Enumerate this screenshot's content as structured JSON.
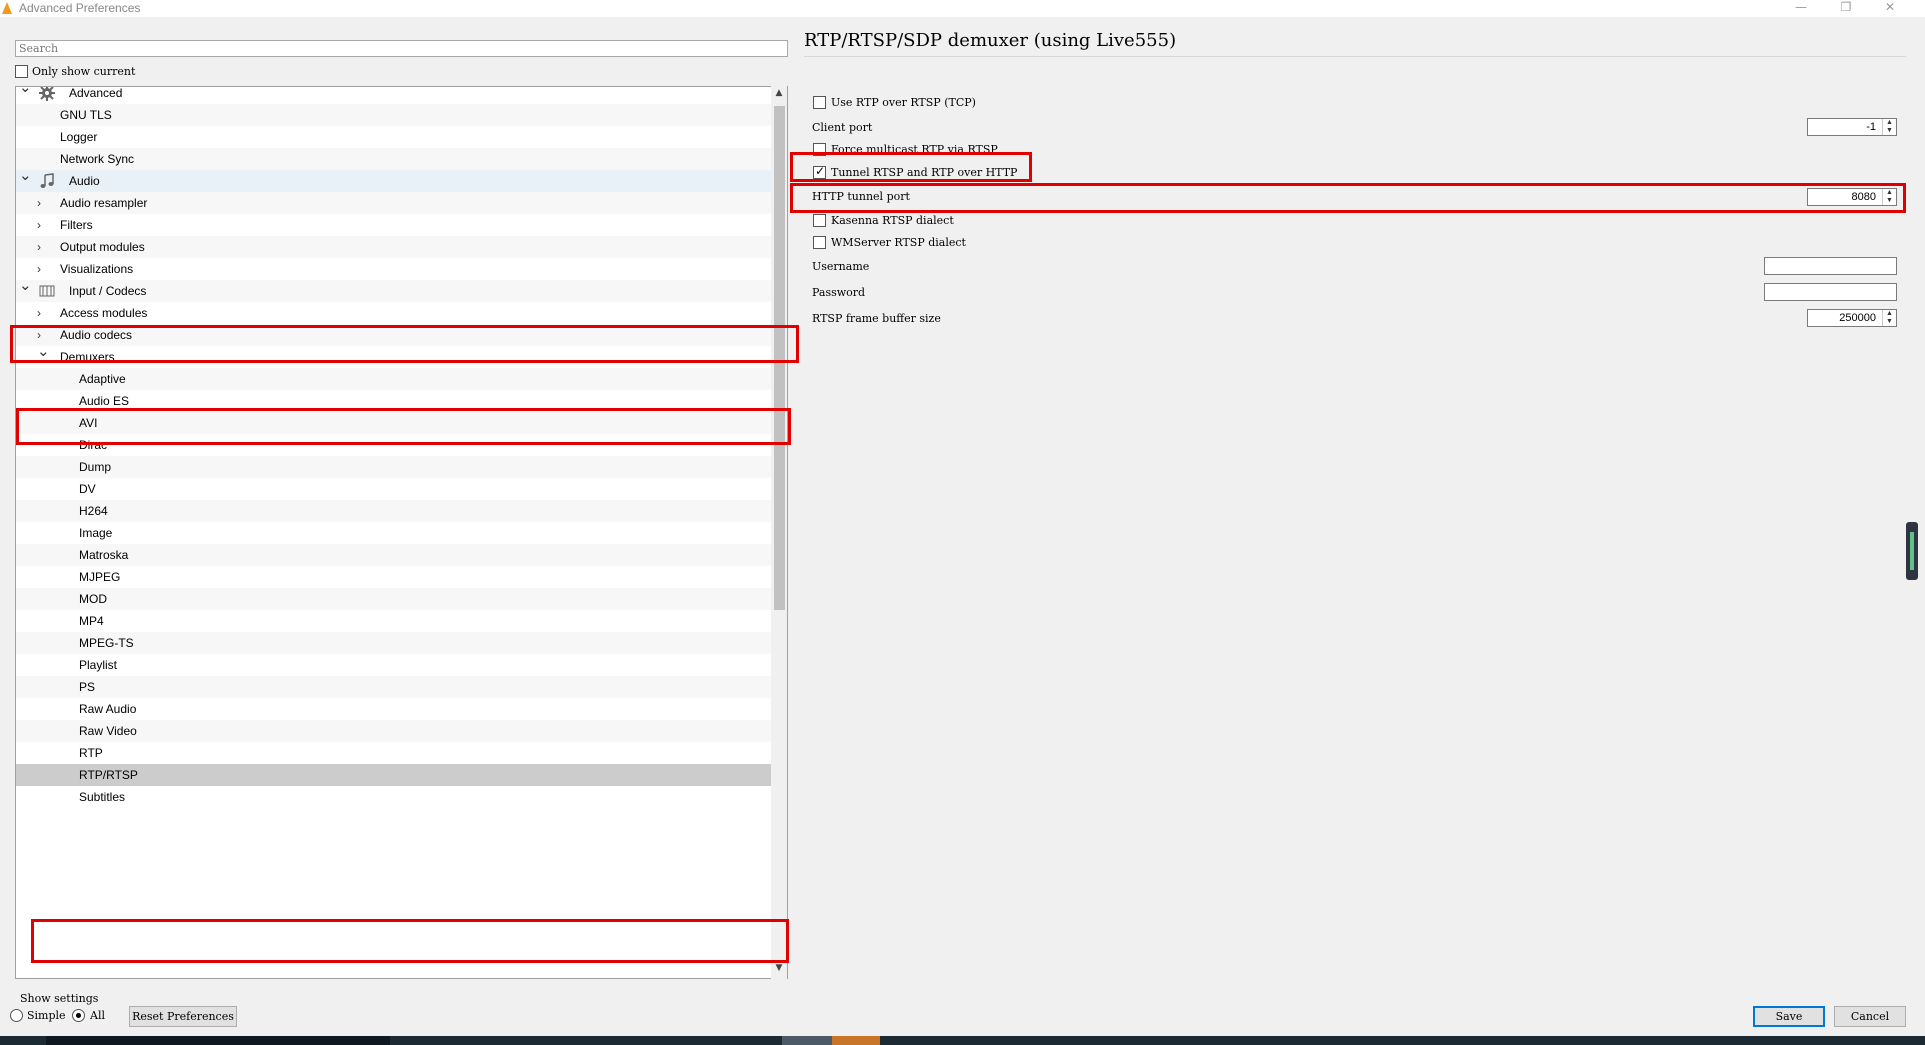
{
  "window": {
    "title": "Advanced Preferences",
    "minimize_icon": "minimize-icon",
    "maximize_icon": "restore-icon",
    "close_icon": "close-icon"
  },
  "left": {
    "search_placeholder": "Search",
    "only_show_current": "Only show current",
    "only_show_current_checked": false,
    "tree": [
      {
        "label": "Advanced",
        "level": 0,
        "expanded": true,
        "icon": "gear-icon"
      },
      {
        "label": "GNU TLS",
        "level": 1
      },
      {
        "label": "Logger",
        "level": 1
      },
      {
        "label": "Network Sync",
        "level": 1
      },
      {
        "label": "Audio",
        "level": 0,
        "expanded": true,
        "icon": "music-note-icon"
      },
      {
        "label": "Audio resampler",
        "level": 1,
        "expanded": false
      },
      {
        "label": "Filters",
        "level": 1,
        "expanded": false
      },
      {
        "label": "Output modules",
        "level": 1,
        "expanded": false
      },
      {
        "label": "Visualizations",
        "level": 1,
        "expanded": false
      },
      {
        "label": "Input / Codecs",
        "level": 0,
        "expanded": true,
        "icon": "codecs-icon"
      },
      {
        "label": "Access modules",
        "level": 1,
        "expanded": false
      },
      {
        "label": "Audio codecs",
        "level": 1,
        "expanded": false
      },
      {
        "label": "Demuxers",
        "level": 1,
        "expanded": true
      },
      {
        "label": "Adaptive",
        "level": 2
      },
      {
        "label": "Audio ES",
        "level": 2
      },
      {
        "label": "AVI",
        "level": 2
      },
      {
        "label": "Dirac",
        "level": 2
      },
      {
        "label": "Dump",
        "level": 2
      },
      {
        "label": "DV",
        "level": 2
      },
      {
        "label": "H264",
        "level": 2
      },
      {
        "label": "Image",
        "level": 2
      },
      {
        "label": "Matroska",
        "level": 2
      },
      {
        "label": "MJPEG",
        "level": 2
      },
      {
        "label": "MOD",
        "level": 2
      },
      {
        "label": "MP4",
        "level": 2
      },
      {
        "label": "MPEG-TS",
        "level": 2
      },
      {
        "label": "Playlist",
        "level": 2
      },
      {
        "label": "PS",
        "level": 2
      },
      {
        "label": "Raw Audio",
        "level": 2
      },
      {
        "label": "Raw Video",
        "level": 2
      },
      {
        "label": "RTP",
        "level": 2
      },
      {
        "label": "RTP/RTSP",
        "level": 2,
        "selected": true
      },
      {
        "label": "Subtitles",
        "level": 2
      }
    ],
    "show_settings_label": "Show settings",
    "simple_label": "Simple",
    "all_label": "All",
    "show_settings_value": "All",
    "reset_button": "Reset Preferences"
  },
  "right": {
    "title": "RTP/RTSP/SDP demuxer (using Live555)",
    "use_rtp_over_rtsp": {
      "label": "Use RTP over RTSP (TCP)",
      "checked": false
    },
    "client_port": {
      "label": "Client port",
      "value": "-1"
    },
    "force_multicast": {
      "label": "Force multicast RTP via RTSP",
      "checked": false
    },
    "tunnel_rtsp": {
      "label": "Tunnel RTSP and RTP over HTTP",
      "checked": true
    },
    "http_tunnel_port": {
      "label": "HTTP tunnel port",
      "value": "8080"
    },
    "kasenna": {
      "label": "Kasenna RTSP dialect",
      "checked": false
    },
    "wmserver": {
      "label": "WMServer RTSP dialect",
      "checked": false
    },
    "username": {
      "label": "Username",
      "value": ""
    },
    "password": {
      "label": "Password",
      "value": ""
    },
    "frame_buffer": {
      "label": "RTSP frame buffer size",
      "value": "250000"
    }
  },
  "footer": {
    "save_button": "Save",
    "cancel_button": "Cancel"
  },
  "colors": {
    "highlight_box": "#e00000",
    "selected_row": "#cccccc",
    "primary_border": "#0078d7"
  }
}
